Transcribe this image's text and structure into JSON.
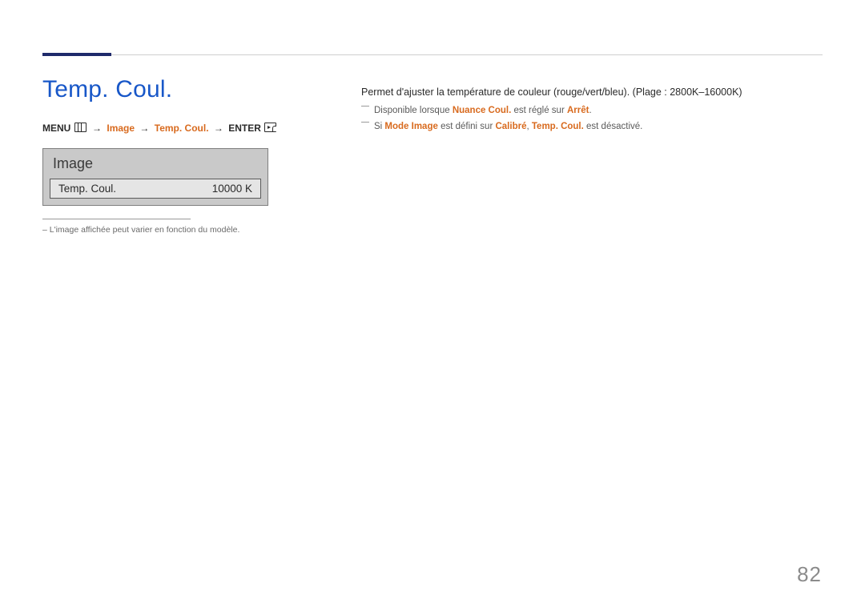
{
  "page": {
    "title": "Temp. Coul.",
    "number": "82"
  },
  "breadcrumb": {
    "menu": "MENU",
    "image": "Image",
    "temp": "Temp. Coul.",
    "enter": "ENTER",
    "arrow": "→"
  },
  "panel": {
    "header": "Image",
    "row_label": "Temp. Coul.",
    "row_value": "10000 K"
  },
  "footnote": {
    "text": "– L'image affichée peut varier en fonction du modèle."
  },
  "description": {
    "main": "Permet d'ajuster la température de couleur (rouge/vert/bleu). (Plage : 2800K–16000K)"
  },
  "notes": {
    "n1": {
      "pre": "Disponible lorsque ",
      "accent1": "Nuance Coul.",
      "mid": " est réglé sur ",
      "accent2": "Arrêt",
      "post": "."
    },
    "n2": {
      "pre": "Si ",
      "accent1": "Mode Image",
      "mid1": " est défini sur ",
      "accent2": "Calibré",
      "mid2": ", ",
      "accent3": "Temp. Coul.",
      "post": " est désactivé."
    }
  }
}
